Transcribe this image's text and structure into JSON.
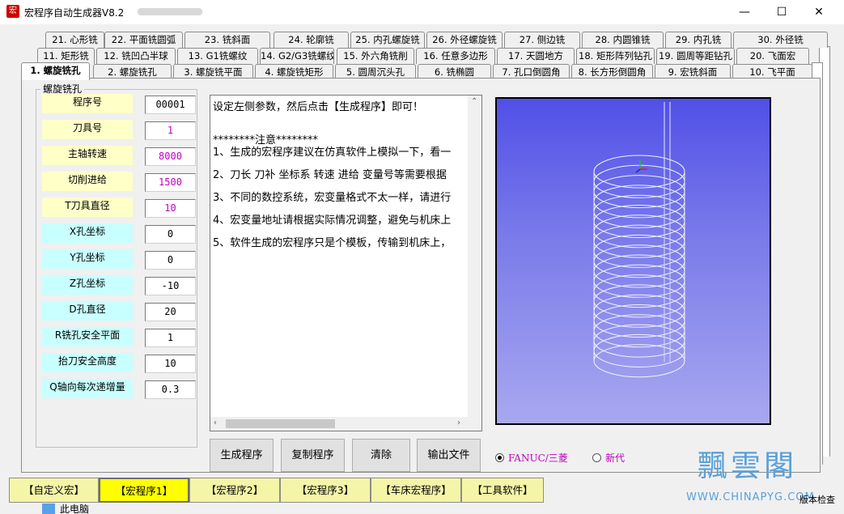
{
  "window": {
    "title": "宏程序自动生成器V8.2",
    "icon_glyph": "宏",
    "minimize": "—",
    "maximize": "☐",
    "close": "✕"
  },
  "tabs_row1": [
    "21. 心形铣",
    "22. 平面铣圆弧",
    "23. 铣斜面",
    "24. 轮廓铣",
    "25. 内孔螺旋铣",
    "26. 外径螺旋铣",
    "27. 侧边铣",
    "28. 内圆锥铣",
    "29. 内孔铣",
    "30. 外径铣"
  ],
  "tabs_row2": [
    "11. 矩形铣",
    "12. 铣凹凸半球",
    "13. G1铣螺纹",
    "14. G2/G3铣螺纹",
    "15. 外六角铣削",
    "16. 任意多边形",
    "17. 天圆地方",
    "18. 矩形阵列钻孔",
    "19. 圆周等距钻孔",
    "20. 飞面宏"
  ],
  "tabs_row3": [
    "1. 螺旋铣孔",
    "2. 螺旋铣孔",
    "3. 螺旋铣平面",
    "4. 螺旋铣矩形",
    "5. 圆周沉头孔",
    "6. 铣椭圆",
    "7. 孔口倒圆角",
    "8. 长方形倒圆角",
    "9. 宏铣斜面",
    "10. 飞平面"
  ],
  "group_title": "螺旋铣孔",
  "params": [
    {
      "label": "程序号",
      "value": "00001"
    },
    {
      "label": "刀具号",
      "value": "1"
    },
    {
      "label": "主轴转速",
      "value": "8000"
    },
    {
      "label": "切削进给",
      "value": "1500"
    },
    {
      "label": "T刀具直径",
      "value": "10"
    },
    {
      "label": "X孔坐标",
      "value": "0"
    },
    {
      "label": "Y孔坐标",
      "value": "0"
    },
    {
      "label": "Z孔坐标",
      "value": "-10"
    },
    {
      "label": "D孔直径",
      "value": "20"
    },
    {
      "label": "R铣孔安全平面",
      "value": "1"
    },
    {
      "label": "抬刀安全高度",
      "value": "10"
    },
    {
      "label": "Q轴向每次递增量",
      "value": "0.3"
    }
  ],
  "text_lines": [
    "设定左侧参数，然后点击【生成程序】即可！",
    "",
    "********注意********",
    "1、生成的宏程序建议在仿真软件上模拟一下，看一",
    "2、刀长 刀补 坐标系 转速 进给 变量号等需要根据",
    "3、不同的数控系统，宏变量格式不太一样，请进行",
    "4、宏变量地址请根据实际情况调整，避免与机床上",
    "5、软件生成的宏程序只是个模板，传输到机床上，"
  ],
  "buttons": {
    "generate": "生成程序",
    "copy": "复制程序",
    "clear": "清除",
    "export": "输出文件"
  },
  "radios": {
    "fanuc": "FANUC/三菱",
    "xindai": "新代",
    "selected": "fanuc"
  },
  "bottom_tabs": [
    "【自定义宏】",
    "【宏程序1】",
    "【宏程序2】",
    "【宏程序3】",
    "【车床宏程序】",
    "【工具软件】"
  ],
  "bottom_active": 1,
  "watermark": {
    "big": "飄雲閣",
    "small": "WWW.CHINAPYG.COM",
    "version": "版本检查"
  },
  "taskbar": "此电脑",
  "colors": {
    "label_yellow": "#ffffc8",
    "label_cyan": "#c8ffff",
    "value_magenta": "#c000c0",
    "viewport_top": "#5050e8",
    "viewport_bottom": "#a8a8f0",
    "bottom_active": "#ffff00",
    "bottom_inactive": "#f5f5a8",
    "watermark_blue": "#5aa0d8"
  }
}
